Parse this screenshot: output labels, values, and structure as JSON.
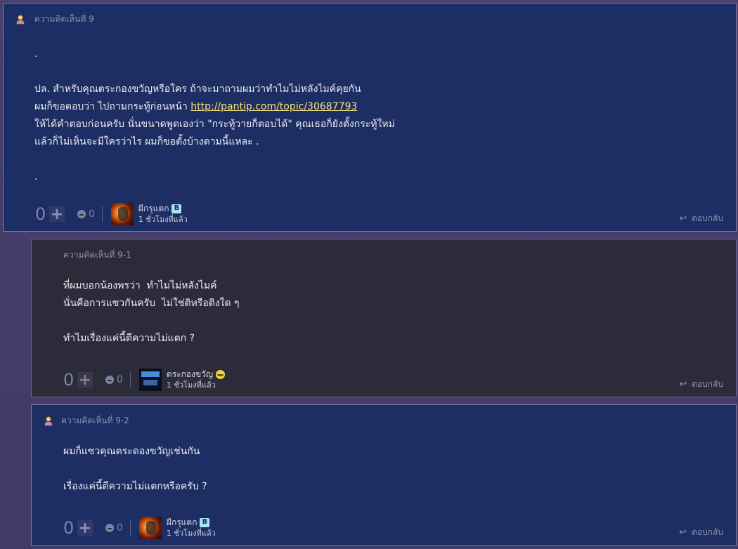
{
  "comments": [
    {
      "header": "ความคิดเห็นที่ 9",
      "lines": [
        ".",
        "",
        "ปล. สำหรับคุณตระกองขวัญหรือใคร ถ้าจะมาถามผมว่าทำไมไม่หลังไมค์คุยกัน",
        "ผมก็ขอตอบว่า ไปถามกระทู้ก่อนหน้า ",
        "ให้ได้คำตอบก่อนครับ นั่นขนาดพูดเองว่า \"กระทู้วายก็ตอบได้\" คุณเธอก็ยังตั้งกระทู้ใหม่",
        "แล้วก็ไม่เห็นจะมีใครว่าไร ผมก็ขอตั้งบ้างตามนี้แหละ .",
        "",
        "."
      ],
      "link": "http://pantip.com/topic/30687793",
      "score": "0",
      "emotion_count": "0",
      "username": "ผีกรุแตก",
      "badge": "B",
      "time": "1 ชั่วโมงที่แล้ว",
      "reply_label": "ตอบกลับ"
    },
    {
      "header": "ความคิดเห็นที่ 9-1",
      "lines": [
        "ที่ผมบอกน้องพรว่า  ทำไมไม่หลังไมค์",
        "นั่นคือการแซวกันครับ  ไม่ใช่ติหรือติงใด ๆ",
        "",
        "ทำไมเรื่องแค่นี้ตีความไม่แตก ?"
      ],
      "score": "0",
      "emotion_count": "0",
      "username": "ตระกองขวัญ",
      "time": "1 ชั่วโมงที่แล้ว",
      "reply_label": "ตอบกลับ"
    },
    {
      "header": "ความคิดเห็นที่ 9-2",
      "lines": [
        "ผมก็แซวคุณตระดองขวัญเช่นกัน",
        "",
        "เรื่องแค่นี้ตีความไม่แตกหรือครับ ?"
      ],
      "score": "0",
      "emotion_count": "0",
      "username": "ผีกรุแตก",
      "badge": "B",
      "time": "1 ชั่วโมงที่แล้ว",
      "reply_label": "ตอบกลับ"
    }
  ],
  "icons": {
    "user": "user-icon",
    "plus": "plus-icon",
    "emotion": "emotion-icon",
    "reply": "reply-icon",
    "smiley": "smiley-icon"
  },
  "colors": {
    "card_blue": "#1c2e63",
    "card_dark": "#2c2b3a",
    "link": "#f6e27a",
    "badge": "#a9e6f5"
  }
}
